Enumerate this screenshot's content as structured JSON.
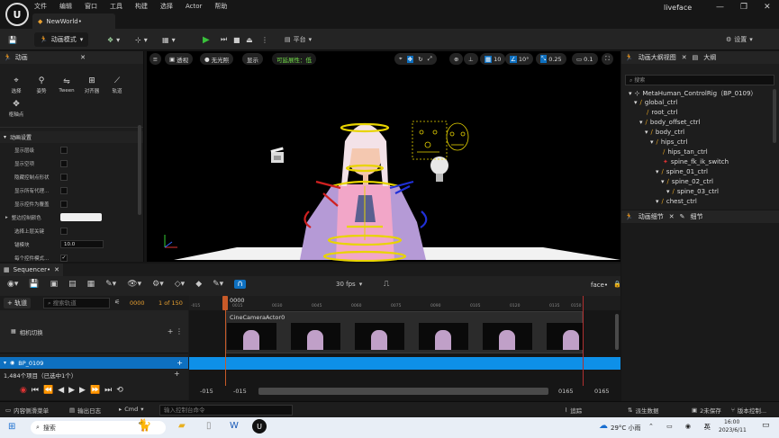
{
  "app": {
    "title": "liveface",
    "logo": "U",
    "document_tab": "NewWorld•",
    "window_controls": [
      "—",
      "❐",
      "✕"
    ]
  },
  "menu": [
    "文件",
    "编辑",
    "窗口",
    "工具",
    "构建",
    "选择",
    "Actor",
    "帮助"
  ],
  "toolbar": {
    "mode_label": "动画模式",
    "platform_label": "平台",
    "settings_label": "设置"
  },
  "anim_panel": {
    "title": "动画",
    "tools": [
      {
        "label": "选择",
        "icon": "cursor-icon"
      },
      {
        "label": "姿势",
        "icon": "pose-icon"
      },
      {
        "label": "Tween",
        "icon": "tween-icon"
      },
      {
        "label": "对齐器",
        "icon": "snapper-icon"
      },
      {
        "label": "轨道",
        "icon": "motion-trail-icon"
      }
    ],
    "pivot_label": "枢轴点",
    "section_title": "动画设置",
    "props": [
      {
        "label": "显示层级"
      },
      {
        "label": "显示空项"
      },
      {
        "label": "隐藏控制点形状"
      },
      {
        "label": "显示所有代理..."
      },
      {
        "label": "显示控件为覆盖"
      }
    ],
    "color_prop": "整边控制颜色",
    "prop_select_back": "选择上层关键",
    "tick_label": "锚模块",
    "tick_value": "10.0",
    "last_prop": "每个控件模式..."
  },
  "viewport": {
    "perspective": "透视",
    "lit": "无光照",
    "show": "显示",
    "scalability": "可延展性：低",
    "grid_size": "10",
    "rot_snap": "10°",
    "scale_snap": "0.25",
    "cam_speed": "0.1"
  },
  "outliner": {
    "tab1": "动画大纲视图",
    "tab2": "大纲",
    "search_placeholder": "搜索",
    "items": [
      "MetaHuman_ControlRig（BP_0109）",
      "global_ctrl",
      "root_ctrl",
      "body_offset_ctrl",
      "body_ctrl",
      "hips_ctrl",
      "hips_tan_ctrl",
      "spine_fk_ik_switch",
      "spine_01_ctrl",
      "spine_02_ctrl",
      "spine_03_ctrl",
      "chest_ctrl"
    ]
  },
  "details": {
    "tab1": "动画细节",
    "tab2": "细节"
  },
  "sequencer": {
    "tab": "Sequencer•",
    "fps": "30 fps",
    "sequence_name": "face•",
    "add_track": "+ 轨道",
    "search_placeholder": "搜索轨道",
    "current_frame": "0000",
    "frame_range": "1 of 150",
    "playhead_label": "0000",
    "ruler": [
      "-015",
      "0015",
      "0030",
      "0045",
      "0060",
      "0075",
      "0090",
      "0105",
      "0120",
      "0135",
      "0150"
    ],
    "tracks": [
      "相机切换",
      "BP_0109"
    ],
    "camera_actor": "CineCameraActor0",
    "items_status": "1,484个项目（已选中1个）",
    "range_start": "-015",
    "range_start2": "-015",
    "range_end": "0165",
    "range_end2": "0165"
  },
  "statusbar": {
    "content_drawer": "内容侧滑菜单",
    "output_log": "输出日志",
    "cmd": "Cmd",
    "console_placeholder": "输入控制台命令",
    "trace": "追踪",
    "derived_data": "派生数据",
    "unsaved": "2未保存",
    "source_control": "版本控制..."
  },
  "taskbar": {
    "search": "搜索",
    "weather": "29°C 小雨",
    "ime": "英",
    "time": "16:00",
    "date": "2023/6/11"
  },
  "colors": {
    "accent_blue": "#0e70c0",
    "play_green": "#39c13b",
    "ctrl_yellow": "#e8d400",
    "ctrl_red": "#d02020",
    "ctrl_blue": "#2030d8",
    "scalability_green": "#74e04a"
  }
}
